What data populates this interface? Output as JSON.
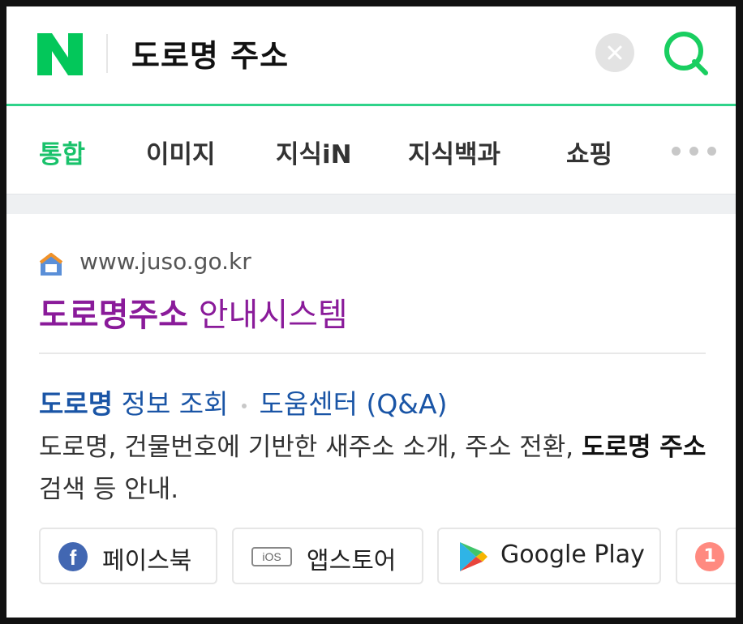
{
  "header": {
    "logo_letter": "N",
    "query": "도로명 주소",
    "icons": {
      "clear": "close-icon",
      "search": "search-icon"
    },
    "colors": {
      "brand": "#03C75A",
      "accent_line": "#2FD38A"
    }
  },
  "tabs": [
    {
      "label": "통합",
      "active": true
    },
    {
      "label": "이미지",
      "active": false
    },
    {
      "label": "지식iN",
      "active": false
    },
    {
      "label": "지식백과",
      "active": false
    },
    {
      "label": "쇼핑",
      "active": false
    }
  ],
  "result": {
    "site_url": "www.juso.go.kr",
    "title_bold": "도로명주소",
    "title_rest": " 안내시스템",
    "sublinks": {
      "link1_bold": "도로명",
      "link1_rest": " 정보 조회",
      "link2": "도움센터 (Q&A)"
    },
    "description": {
      "part1": "도로명, 건물번호에 기반한 새주소 소개, 주소 전환, ",
      "bold1": "도로명 주소",
      "part2": " 검색 등 안내."
    },
    "chips": [
      {
        "label": "페이스북",
        "icon": "facebook-icon"
      },
      {
        "label": "앱스토어",
        "icon": "ios-icon",
        "icon_text": "iOS"
      },
      {
        "label": "Google Play",
        "icon": "google-play-icon"
      },
      {
        "label": "",
        "icon": "badge-icon",
        "icon_text": "1"
      }
    ],
    "colors": {
      "title": "#8A1B9A",
      "link": "#1A55A6"
    }
  }
}
